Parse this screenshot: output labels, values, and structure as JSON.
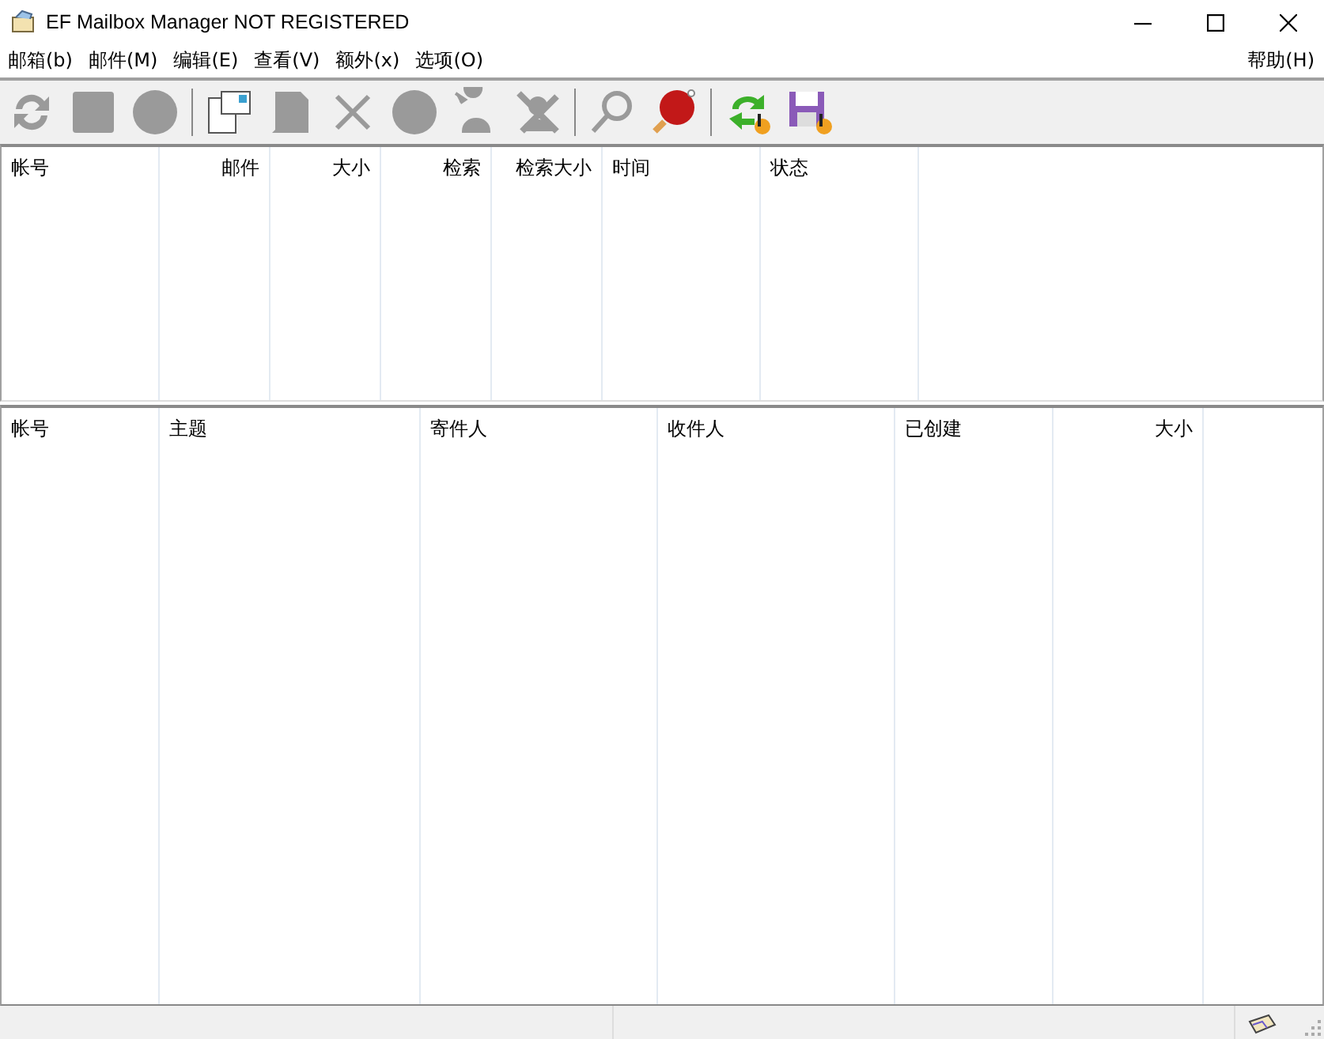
{
  "window": {
    "title": "EF Mailbox Manager NOT REGISTERED"
  },
  "menu": {
    "items": [
      "邮箱(b)",
      "邮件(M)",
      "编辑(E)",
      "查看(V)",
      "额外(x)",
      "选项(O)"
    ],
    "help": "帮助(H)"
  },
  "toolbar": [
    {
      "kind": "refresh",
      "disabled": true
    },
    {
      "kind": "square",
      "disabled": true
    },
    {
      "kind": "circle",
      "disabled": true
    },
    {
      "kind": "sep"
    },
    {
      "kind": "new",
      "disabled": false
    },
    {
      "kind": "page",
      "disabled": true
    },
    {
      "kind": "delete",
      "disabled": true
    },
    {
      "kind": "circle",
      "disabled": true
    },
    {
      "kind": "person",
      "disabled": true
    },
    {
      "kind": "crossperson",
      "disabled": true
    },
    {
      "kind": "sep"
    },
    {
      "kind": "search",
      "disabled": true
    },
    {
      "kind": "paddle",
      "disabled": false
    },
    {
      "kind": "sep"
    },
    {
      "kind": "sync",
      "disabled": false
    },
    {
      "kind": "save",
      "disabled": false
    }
  ],
  "accounts_table": {
    "columns": [
      "帐号",
      "邮件",
      "大小",
      "检索",
      "检索大小",
      "时间",
      "状态"
    ]
  },
  "messages_table": {
    "columns": [
      "帐号",
      "主题",
      "寄件人",
      "收件人",
      "已创建",
      "大小"
    ]
  }
}
